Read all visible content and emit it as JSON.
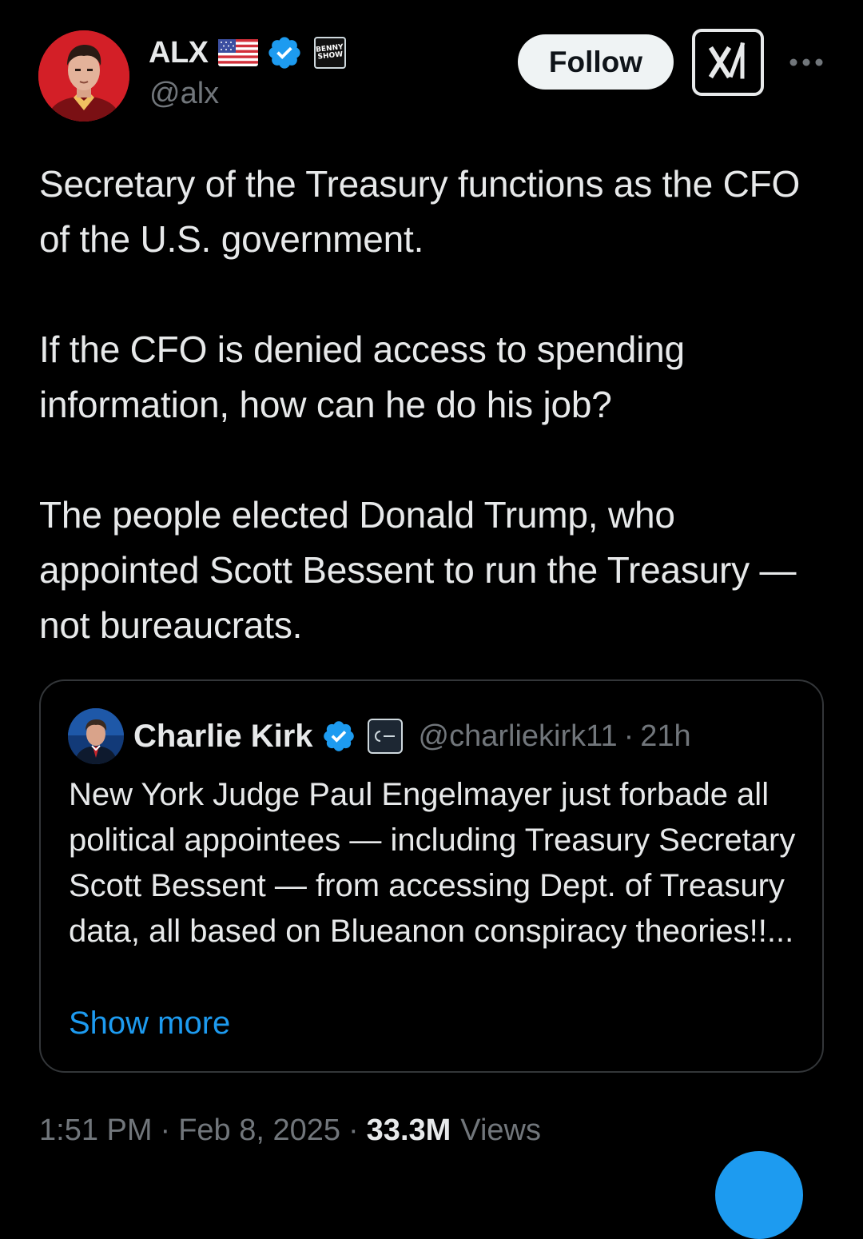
{
  "author": {
    "display_name": "ALX",
    "handle": "@alx",
    "flag_icon": "us-flag-icon",
    "verified_icon": "verified-badge-icon",
    "affiliate_badge_text": "BENNY SHOW"
  },
  "actions": {
    "follow_label": "Follow",
    "grok_icon": "grok-icon",
    "more_icon": "more-dots-icon"
  },
  "tweet": {
    "paragraphs": [
      "Secretary of the Treasury functions as the CFO of the U.S. government.",
      "If the CFO is denied access to spending information, how can he do his job?",
      "The people elected Donald Trump, who appointed Scott Bessent to run the Treasury — not bureaucrats."
    ]
  },
  "quote": {
    "display_name": "Charlie Kirk",
    "handle": "@charliekirk11",
    "separator": "·",
    "time": "21h",
    "text": "New York Judge Paul Engelmayer just forbade all political appointees — including Treasury Secretary Scott Bessent — from accessing Dept. of Treasury data, all based on Blueanon conspiracy theories!!...",
    "show_more": "Show more"
  },
  "meta": {
    "time": "1:51 PM",
    "separator": "·",
    "date": "Feb 8, 2025",
    "views_count": "33.3M",
    "views_label": "Views"
  },
  "colors": {
    "background": "#000000",
    "text_primary": "#e7e9ea",
    "text_secondary": "#71767b",
    "accent": "#1d9bf0",
    "border": "#333639"
  }
}
